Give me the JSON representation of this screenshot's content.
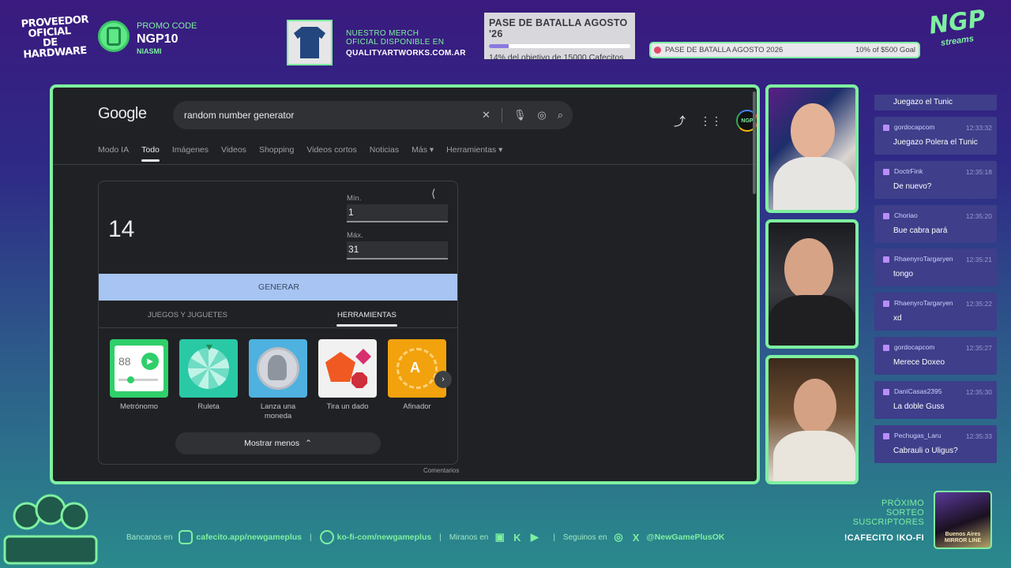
{
  "overlay": {
    "provider_text": "PROVEEDOR OFICIAL DE HARDWARE",
    "promo": {
      "label": "PROMO CODE",
      "code": "NGP10",
      "user": "NIASMI"
    },
    "merch": {
      "line1": "NUESTRO MERCH",
      "line2": "OFICIAL DISPONIBLE EN",
      "url": "QUALITYARTWORKS.COM.AR"
    },
    "battle_pass": {
      "title": "PASE DE BATALLA AGOSTO '26",
      "progress": 0.14,
      "subtitle": "14% del objetivo de 15000 Cafecitos"
    },
    "goal_bar": {
      "label": "PASE DE BATALLA AGOSTO 2026",
      "right": "10% of $500 Goal",
      "progress": 0.1
    },
    "logo": {
      "big": "NGP",
      "small": "streams"
    }
  },
  "browser": {
    "google_logo": "Google",
    "search": {
      "query": "random number generator"
    },
    "tabs": [
      "Modo IA",
      "Todo",
      "Imágenes",
      "Videos",
      "Shopping",
      "Videos cortos",
      "Noticias",
      "Más ▾",
      "Herramientas ▾"
    ],
    "active_tab": "Todo",
    "avatar_text": "NGP",
    "rng": {
      "result": "14",
      "min_label": "Mín.",
      "min_value": "1",
      "max_label": "Máx.",
      "max_value": "31",
      "generate_label": "GENERAR",
      "tab_games": "JUEGOS Y JUGUETES",
      "tab_tools": "HERRAMIENTAS",
      "tools": [
        {
          "label": "Metrónomo",
          "color": "#2fcf6a"
        },
        {
          "label": "Ruleta",
          "color": "#29c9a6"
        },
        {
          "label": "Lanza una moneda",
          "color": "#4fb1e0"
        },
        {
          "label": "Tira un dado",
          "color": "#f1f1f1"
        },
        {
          "label": "Afinador",
          "color": "#f2a20d"
        }
      ],
      "metronome_value": "88",
      "tuner_letter": "A",
      "show_less": "Mostrar menos",
      "feedback": "Comentarios"
    }
  },
  "chat": {
    "partial_text": "Juegazo el Tunic",
    "messages": [
      {
        "user": "gordocapcom",
        "time": "12:33:32",
        "text": "Juegazo Polera el Tunic"
      },
      {
        "user": "DoctrFink",
        "time": "12:35:18",
        "text": "De nuevo?"
      },
      {
        "user": "Choriao",
        "time": "12:35:20",
        "text": "Bue cabra pará"
      },
      {
        "user": "RhaenyroTargaryen",
        "time": "12:35:21",
        "text": "tongo"
      },
      {
        "user": "RhaenyroTargaryen",
        "time": "12:35:22",
        "text": "xd"
      },
      {
        "user": "gordocapcom",
        "time": "12:35:27",
        "text": "Merece Doxeo"
      },
      {
        "user": "DaniCasas2395",
        "time": "12:35:30",
        "text": "La doble Guss"
      },
      {
        "user": "Pechugas_Laru",
        "time": "12:35:33",
        "text": "Cabrauli o Uligus?"
      }
    ]
  },
  "footer": {
    "bancanos": "Bancanos en",
    "cafecito": "cafecito.app/newgameplus",
    "kofi": "ko-fi-com/newgameplus",
    "miranos": "Miranos en",
    "seguinos": "Seguinos en",
    "handle": "@NewGamePlusOK",
    "sep": "|",
    "proximo": [
      "PRÓXIMO",
      "SORTEO",
      "SUSCRIPTORES"
    ],
    "commands": "!CAFECITO  !KO-FI",
    "sorteo_game": "Buenos Aires MIRROR LINE"
  },
  "colors": {
    "accent": "#7ef0a0",
    "chat_bg": "#3e3e8a",
    "google_bg": "#202124",
    "generate_btn": "#a7c4f2"
  }
}
